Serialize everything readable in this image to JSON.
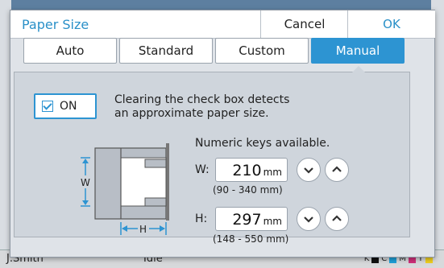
{
  "background": {
    "user": "J.Smith",
    "status": "Idle",
    "ink_labels": [
      "K",
      "C",
      "M",
      "Y"
    ],
    "ink_colors": [
      "#111111",
      "#1ea0d8",
      "#d0307a",
      "#f0d020"
    ]
  },
  "dialog": {
    "title": "Paper Size",
    "cancel_label": "Cancel",
    "ok_label": "OK",
    "tabs": [
      {
        "label": "Auto",
        "selected": false
      },
      {
        "label": "Standard",
        "selected": false
      },
      {
        "label": "Custom",
        "selected": false
      },
      {
        "label": "Manual",
        "selected": true
      }
    ]
  },
  "manual": {
    "on_label": "ON",
    "on_checked": true,
    "description_line1": "Clearing the check box detects",
    "description_line2": "an approximate paper size.",
    "numeric_note": "Numeric keys available.",
    "width": {
      "label": "W:",
      "value": "210",
      "unit": "mm",
      "range": "(90 - 340 mm)"
    },
    "height": {
      "label": "H:",
      "value": "297",
      "unit": "mm",
      "range": "(148 - 550 mm)"
    },
    "diagram_w_label": "W",
    "diagram_h_label": "H"
  },
  "colors": {
    "accent": "#2d94d2",
    "title_text": "#2a90c8",
    "panel_bg": "#cfd5dc"
  }
}
